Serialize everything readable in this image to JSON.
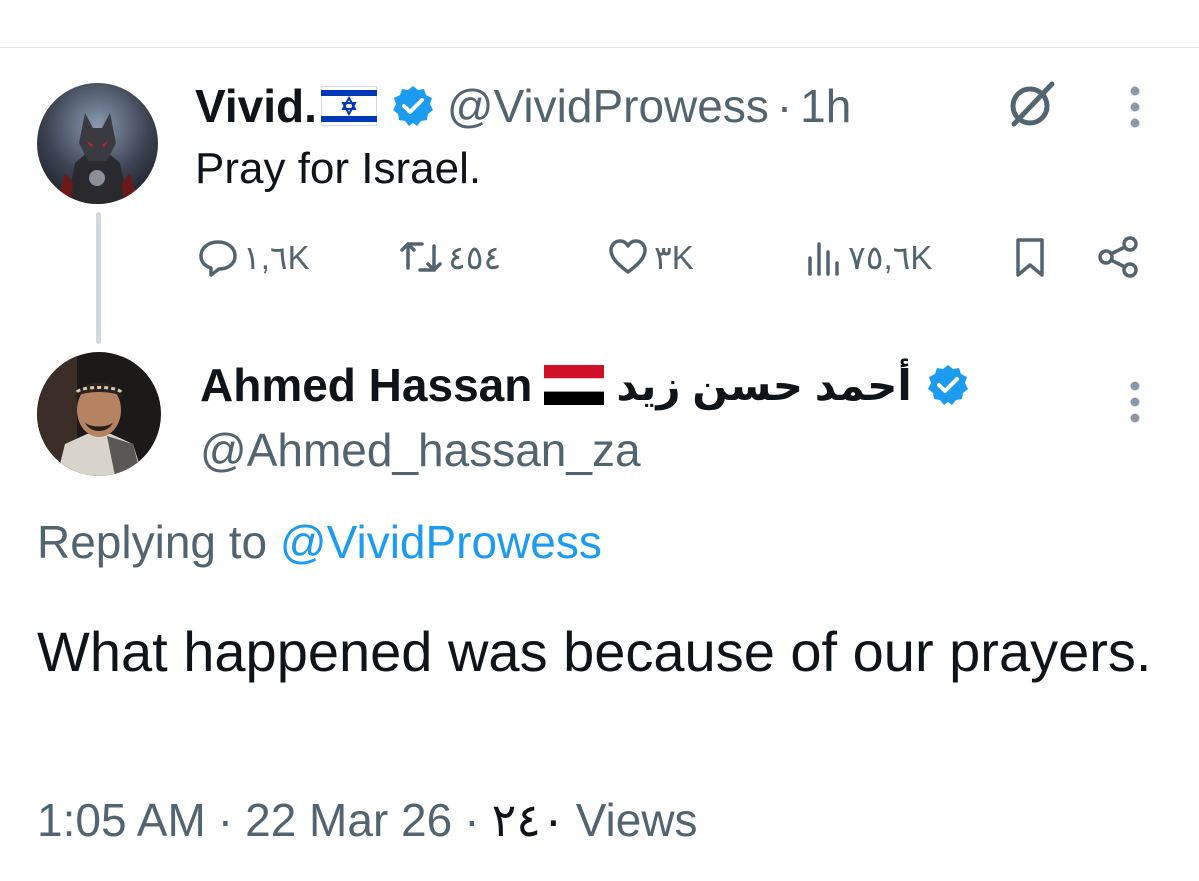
{
  "tweet_1": {
    "display_name": "Vivid.",
    "handle": "@VividProwess",
    "separator": "·",
    "time": "1h",
    "text": "Pray for Israel.",
    "actions": {
      "replies": "١,٦K",
      "retweets": "٤٥٤",
      "likes": "٣K",
      "views": "٧٥,٦K"
    }
  },
  "tweet_2": {
    "display_name": "Ahmed Hassan",
    "arabic_name": "أحمد حسن زيد",
    "handle": "@Ahmed_hassan_za",
    "replying_prefix": "Replying to",
    "replying_to": "@VividProwess",
    "text": "What happened was because of our prayers.",
    "time": "1:05 AM",
    "separator": "·",
    "date": "22 Mar 26",
    "views_count": "٢٤٠",
    "views_label": "Views"
  },
  "icons": {
    "verified": "verified-badge-icon",
    "more": "more-options-icon",
    "grok": "grok-icon",
    "reply": "reply-icon",
    "retweet": "retweet-icon",
    "like": "heart-icon",
    "views": "views-chart-icon",
    "bookmark": "bookmark-icon",
    "share": "share-icon"
  },
  "colors": {
    "accent": "#1d9bf0",
    "text_primary": "#0f1419",
    "text_secondary": "#536471",
    "thread_line": "#cfd9de"
  }
}
